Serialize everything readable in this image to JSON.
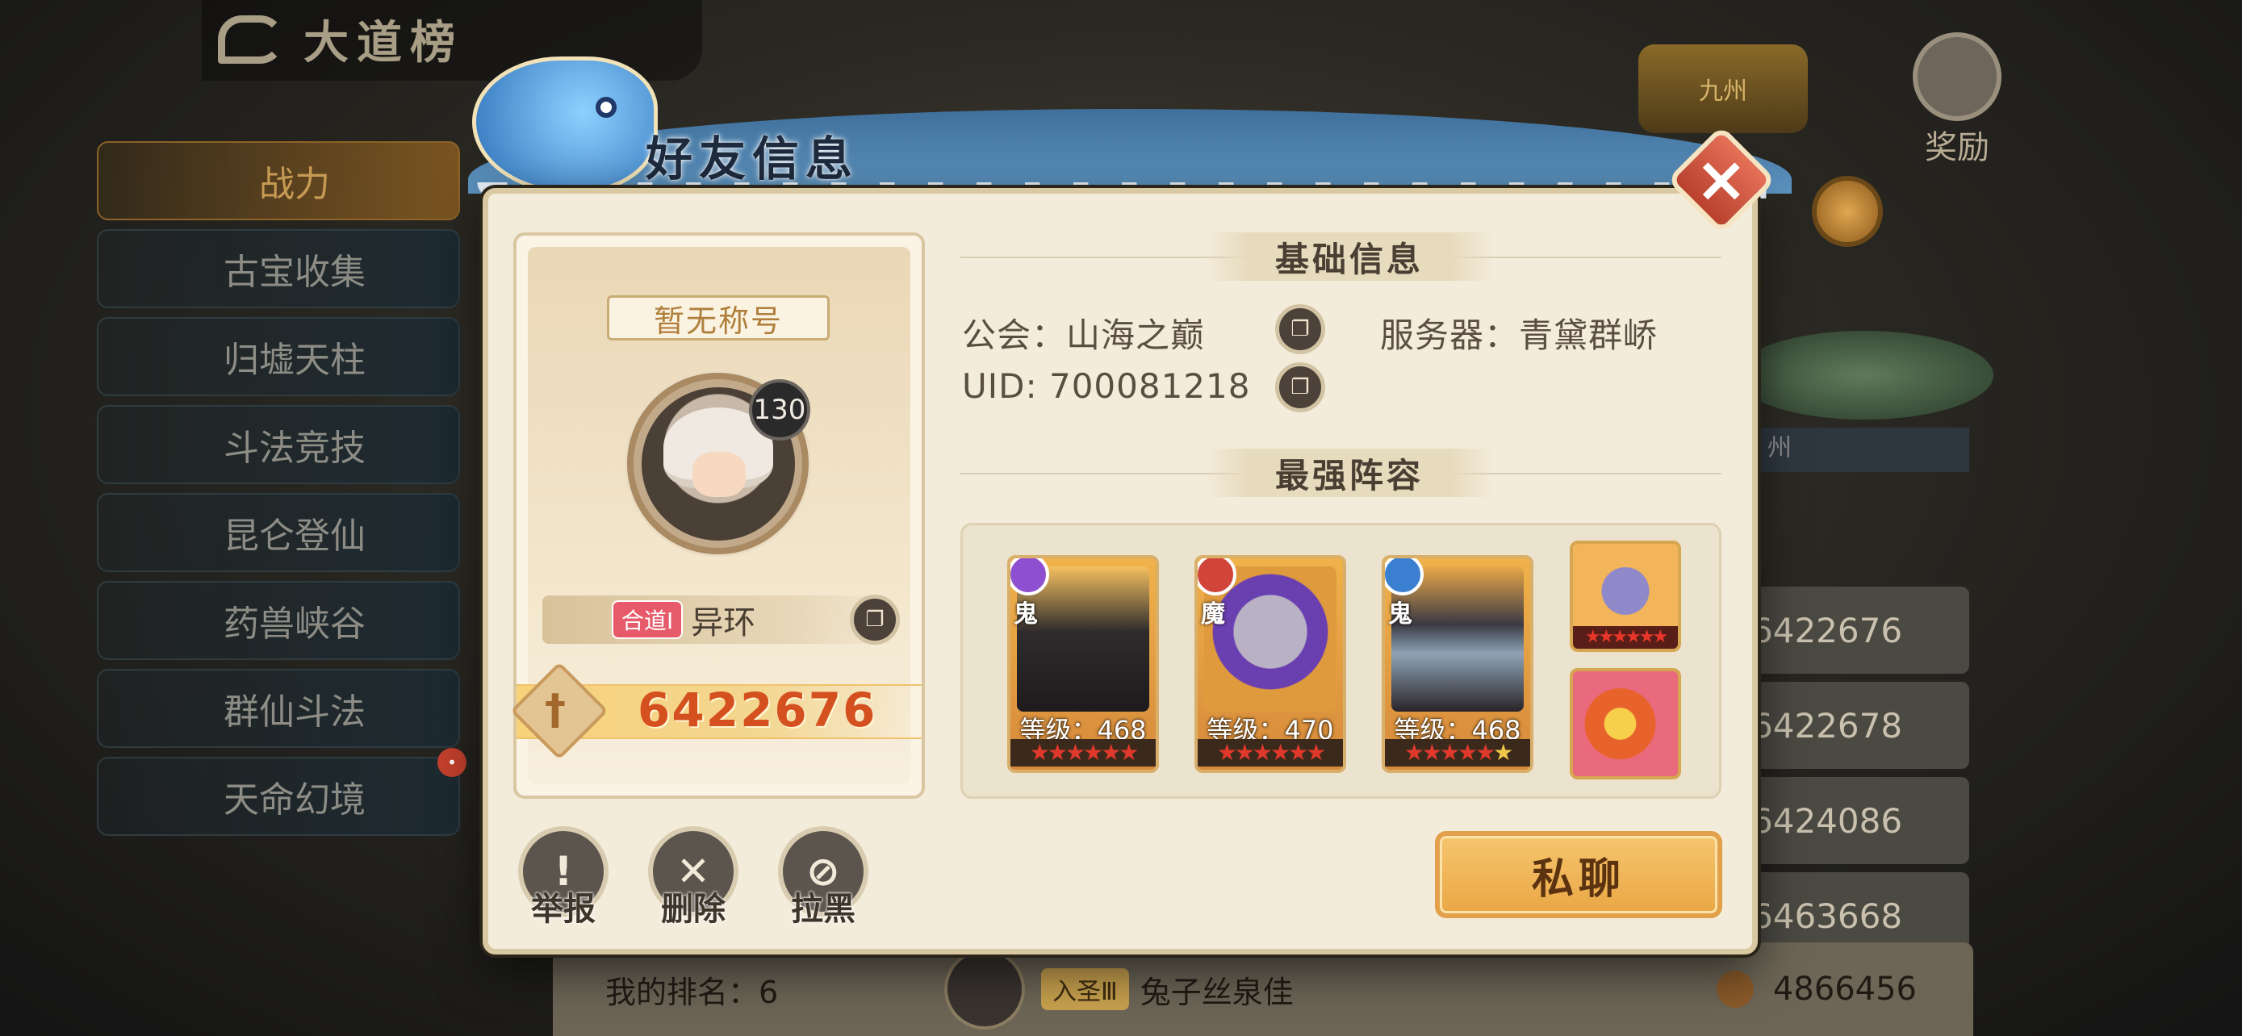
{
  "background": {
    "board_title": "大道榜",
    "reward_label": "奖励",
    "crown_label": "九州",
    "side_tabs": [
      "战力",
      "古宝收集",
      "归墟天柱",
      "斗法竞技",
      "昆仑登仙",
      "药兽峡谷",
      "群仙斗法",
      "天命幻境"
    ],
    "active_tab": "战力",
    "rank_rows": [
      "6422676",
      "6422678",
      "6424086",
      "6463668"
    ],
    "partial_label": "州",
    "my_rank_label": "我的排名：6",
    "my_badge": "入圣Ⅲ",
    "my_name": "兔子丝泉佳",
    "my_power": "4866456"
  },
  "dialog": {
    "title": "好友信息",
    "close_icon": "close-icon"
  },
  "profile": {
    "title_plate": "暂无称号",
    "level": "130",
    "rank_badge": "合道Ⅰ",
    "name": "异环",
    "power": "6422676"
  },
  "basic_info": {
    "heading": "基础信息",
    "guild_label": "公会：山海之巅",
    "server_label": "服务器：青黛群峤",
    "uid_label": "UID: 700081218"
  },
  "lineup": {
    "heading": "最强阵容",
    "heroes": [
      {
        "race": "鬼",
        "level_label": "等级：468",
        "stars": "★★★★★★",
        "faction_color": "#8e4fd0"
      },
      {
        "race": "魔",
        "level_label": "等级：470",
        "stars": "★★★★★★",
        "faction_color": "#d0443a"
      },
      {
        "race": "鬼",
        "level_label": "等级：468",
        "stars": "★★★★★",
        "faction_color": "#3a7fd0"
      }
    ],
    "equips": [
      {
        "name": "hammer-equip",
        "stars": "★★★★★★"
      },
      {
        "name": "flame-pet",
        "stars": ""
      }
    ]
  },
  "actions": {
    "report": "举报",
    "delete": "删除",
    "block": "拉黑",
    "chat": "私聊"
  }
}
